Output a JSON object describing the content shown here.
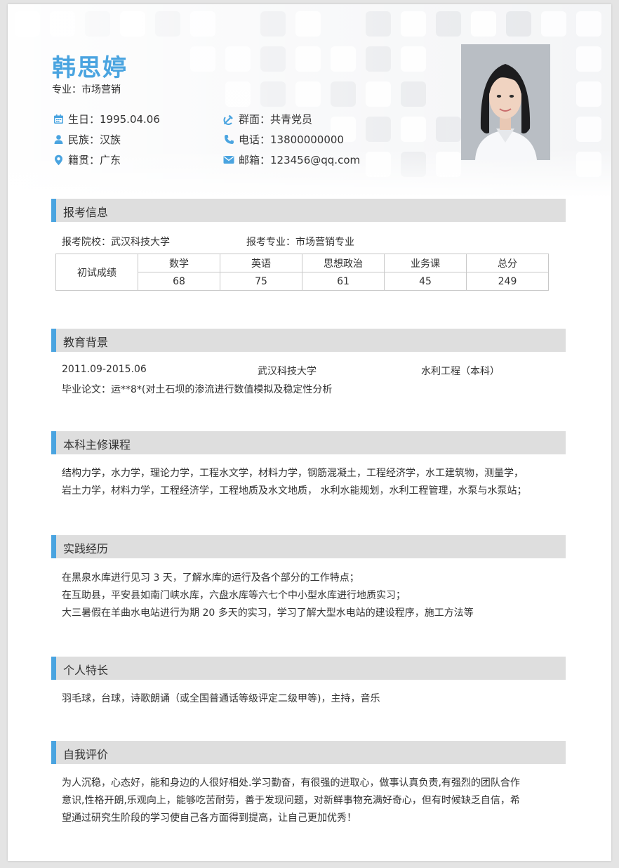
{
  "profile": {
    "name": "韩思婷",
    "major": "专业：市场营销",
    "birthday": "生日：1995.04.06",
    "ethnicity": "民族：汉族",
    "hometown": "籍贯：广东",
    "political": "群面：共青党员",
    "phone": "电话：13800000000",
    "email": "邮箱：123456@qq.com"
  },
  "sections": {
    "exam": {
      "title": "报考信息",
      "school": "报考院校：武汉科技大学",
      "major": "报考专业：市场营销专业",
      "row_label": "初试成绩",
      "headers": [
        "数学",
        "英语",
        "思想政治",
        "业务课",
        "总分"
      ],
      "scores": [
        "68",
        "75",
        "61",
        "45",
        "249"
      ]
    },
    "education": {
      "title": "教育背景",
      "period": "2011.09-2015.06",
      "school": "武汉科技大学",
      "degree": "水利工程（本科）",
      "thesis": "毕业论文：运**8*(对土石坝的渗流进行数值模拟及稳定性分析"
    },
    "courses": {
      "title": "本科主修课程",
      "lines": [
        "结构力学，水力学，理论力学，工程水文学，材料力学，钢筋混凝土，工程经济学，水工建筑物，测量学，",
        "岩土力学，材料力学，工程经济学，工程地质及水文地质， 水利水能规划，水利工程管理，水泵与水泵站；"
      ]
    },
    "practice": {
      "title": "实践经历",
      "lines": [
        "在黑泉水库进行见习 3 天，了解水库的运行及各个部分的工作特点；",
        "在互助县，平安县如南门峡水库，六盘水库等六七个中小型水库进行地质实习；",
        "大三暑假在羊曲水电站进行为期 20 多天的实习，学习了解大型水电站的建设程序，施工方法等"
      ]
    },
    "skills": {
      "title": "个人特长",
      "text": "羽毛球，台球，诗歌朗诵（或全国普通话等级评定二级甲等)，主持，音乐"
    },
    "self": {
      "title": "自我评价",
      "lines": [
        "为人沉稳，心态好，能和身边的人很好相处.学习勤奋，有很强的进取心，做事认真负责,有强烈的团队合作",
        "意识,性格开朗,乐观向上，能够吃苦耐劳，善于发现问题，对新鲜事物充满好奇心，但有时候缺乏自信，希",
        "望通过研究生阶段的学习使自己各方面得到提高，让自己更加优秀！"
      ]
    }
  },
  "icons": {
    "calendar": "calendar-icon",
    "person": "person-icon",
    "location": "location-pin-icon",
    "party": "party-emblem-icon",
    "phone": "phone-icon",
    "mail": "mail-icon"
  },
  "colors": {
    "accent": "#4aa4e0",
    "bar": "#dedede",
    "text": "#333333"
  }
}
